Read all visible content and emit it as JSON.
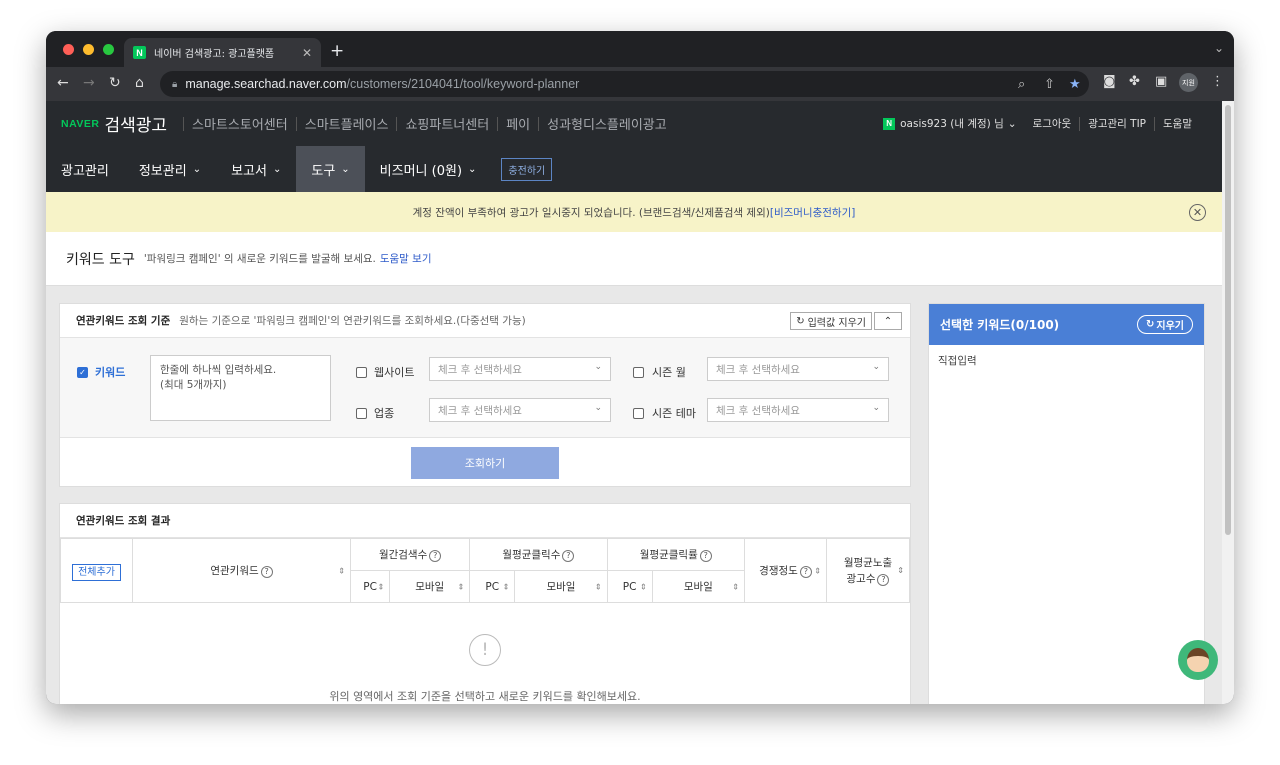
{
  "browser": {
    "tab_title": "네이버 검색광고: 광고플랫폼",
    "tab_favicon": "N",
    "url_host": "manage.searchad.naver.com",
    "url_path": "/customers/2104041/tool/keyword-planner",
    "profile": "지원"
  },
  "gnb": {
    "logo": "NAVER",
    "brand": "검색광고",
    "services": [
      "스마트스토어센터",
      "스마트플레이스",
      "쇼핑파트너센터",
      "페이",
      "성과형디스플레이광고"
    ],
    "account_badge": "N",
    "account": "oasis923 (내 계정) 님",
    "logout": "로그아웃",
    "tip": "광고관리 TIP",
    "help": "도움말"
  },
  "menu": {
    "items": [
      "광고관리",
      "정보관리",
      "보고서",
      "도구",
      "비즈머니 (0원)"
    ],
    "charge": "충전하기"
  },
  "notice": {
    "text": "계정 잔액이 부족하여 광고가 일시중지 되었습니다. (브랜드검색/신제품검색 제외)",
    "link": "[비즈머니충전하기]"
  },
  "title": {
    "heading": "키워드 도구",
    "desc": "'파워링크 캠페인' 의 새로운 키워드를 발굴해 보세요.",
    "help_link": "도움말 보기"
  },
  "criteria": {
    "title": "연관키워드 조회 기준",
    "desc": "원하는 기준으로 '파워링크 캠페인'의 연관키워드를 조회하세요.(다중선택 가능)",
    "clear_btn": "입력값 지우기",
    "keyword_label": "키워드",
    "keyword_placeholder_1": "한줄에 하나씩 입력하세요.",
    "keyword_placeholder_2": "(최대 5개까지)",
    "website_label": "웹사이트",
    "industry_label": "업종",
    "season_month_label": "시즌 월",
    "season_theme_label": "시즌 테마",
    "select_placeholder": "체크 후 선택하세요",
    "search_btn": "조회하기"
  },
  "results": {
    "title": "연관키워드 조회 결과",
    "add_all": "전체추가",
    "col_keyword": "연관키워드",
    "col_monthly_search": "월간검색수",
    "col_avg_clicks": "월평균클릭수",
    "col_avg_ctr": "월평균클릭률",
    "col_competition": "경쟁정도",
    "col_avg_ads_1": "월평균노출",
    "col_avg_ads_2": "광고수",
    "pc": "PC",
    "mobile": "모바일",
    "empty_msg": "위의 영역에서 조회 기준을 선택하고 새로운 키워드를 확인해보세요."
  },
  "selected": {
    "title": "선택한 키워드(0/100)",
    "clear": "지우기",
    "direct_input": "직접입력"
  }
}
